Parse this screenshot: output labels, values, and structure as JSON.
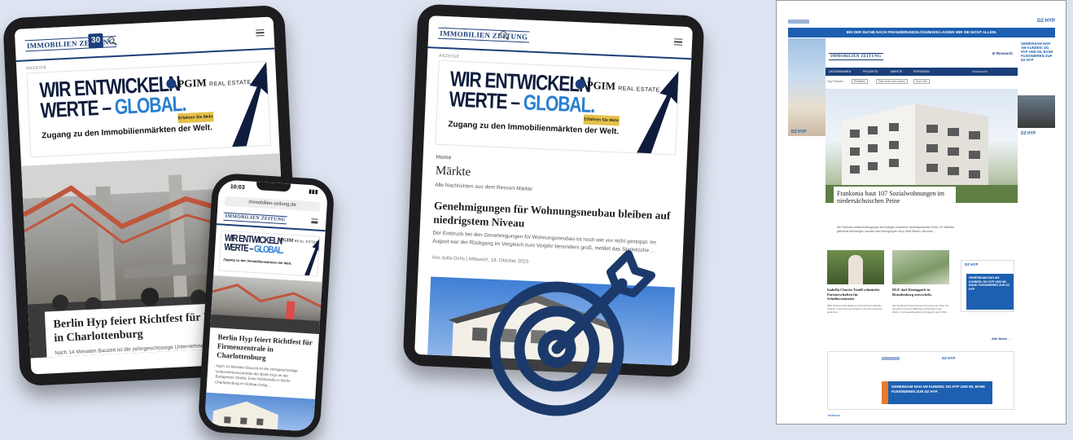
{
  "site": {
    "logo": "IMMOBILIEN ZEITUNG",
    "badge": "30",
    "url": "immobilien-zeitung.de",
    "phone_time": "10:03"
  },
  "ad": {
    "label": "ANZEIGE",
    "line1": "WIR ENTWICKELN",
    "line2": "WERTE – ",
    "line2_accent": "GLOBAL.",
    "sub": "Zugang zu den Immobilienmärkten der Welt.",
    "button": "Erfahren Sie Mehr",
    "brand": "PGIM",
    "brand_suffix": "REAL ESTATE"
  },
  "tablet1": {
    "headline": "Berlin Hyp feiert Richtfest für Firmenzentrale in Charlottenburg",
    "teaser": "Nach 14 Monaten Bauzeit ist die zehngeschossige Unternehmenszentrale der Berlin Hyp an der Budapester Straße, Ecke Keithstraße in Berlin Charlottenburg"
  },
  "phone": {
    "headline": "Berlin Hyp feiert Richtfest für Firmenzentrale in Charlottenburg",
    "teaser": "Nach 14 Monaten Bauzeit ist die zehngeschossige Unternehmenszentrale der Berlin Hyp an der Budapester Straße, Ecke Keithstraße in Berlin Charlottenburg im Rohbau fertig ..."
  },
  "tablet2": {
    "breadcrumb": "Home",
    "section": "Märkte",
    "section_sub": "Alle Nachrichten aus dem Ressort Märkte",
    "headline": "Genehmigungen für Wohnungsneubau bleiben auf niedrigstem Niveau",
    "teaser": "Der Einbruch bei den Genehmigungen für Wohnungsneubau ist noch wie vor nicht gestoppt. Im August war der Rückgang im Vergleich zum Vorjahr besonders groß, meldet das Statistische ...",
    "meta": "Von Jutta Ochs | Mittwoch, 18. Oktober 2023"
  },
  "desktop": {
    "banner": "BEI DER SUCHE NACH FINANZIERUNGSLÖSUNGEN LASSEN WIR SIE NICHT ALLEIN.",
    "dzhyp": "DZ HYP",
    "nav_items": [
      "UNTERNEHMEN",
      "PROJEKTE",
      "MÄRKTE",
      "PERSONEN"
    ],
    "top_links": [
      "Top-Themen",
      "Richtfest",
      "Das Gute zum Lesen",
      "Zum Ziel"
    ],
    "search_placeholder": "Artikelsuche",
    "iz_research": "IZ Research",
    "main_headline": "Frankonia baut 107 Sozialwohnungen im niedersächsischen Peine",
    "main_teaser": "Die Frankonia Unternehmensgruppe aus Erlangen errichtet im niedersächsischen Peine 107 öffentlich geförderte Wohnungen, darunter zwei Wohngruppen mit je zwölf Plätzen. Das erste ...",
    "card1_headline": "Isabella Chacón Troidl schmiedet Partnerschaften für Schulinvestments",
    "card1_teaser": "BNP Paribas Real Estate-Investmentchef Isabella Chacón Troidl setzt auf Schulen und will Investoren gewinnen ...",
    "card2_headline": "DLE darf Kinzigpark in Brandenburg entwickeln",
    "card2_teaser": "Die Stadtverordnetenversammlung hat den Weg frei gemacht für die großflächige Entwicklung des Wohn- und Gewerbegebiets Kinzigpark durch DLE ...",
    "side_ad": "GEMEINSAM NAH AM KUNDEN: DG HYP UND WL BANK FUSIONIEREN ZUR DZ HYP",
    "more_link": "Alle News →",
    "bottom_ad": "GEMEINSAM NAH AM KUNDEN: DG HYP UND WL BANK FUSIONIEREN ZUR DZ HYP.",
    "jubilaeum": "Jubiläum",
    "side_label": "GEMEINSAM NAH AM KUNDEN: DG HYP UND WL BANK FUSIONIEREN ZUR DZ HYP"
  },
  "colors": {
    "background": "#dde3f1",
    "navy": "#1b3f7a",
    "target": "#1b3a6b",
    "ad_accent": "#2a7fd0",
    "dz_blue": "#1d5fb0",
    "gold": "#e5c04a"
  },
  "icons": [
    "target-icon",
    "search-icon",
    "menu-icon"
  ]
}
